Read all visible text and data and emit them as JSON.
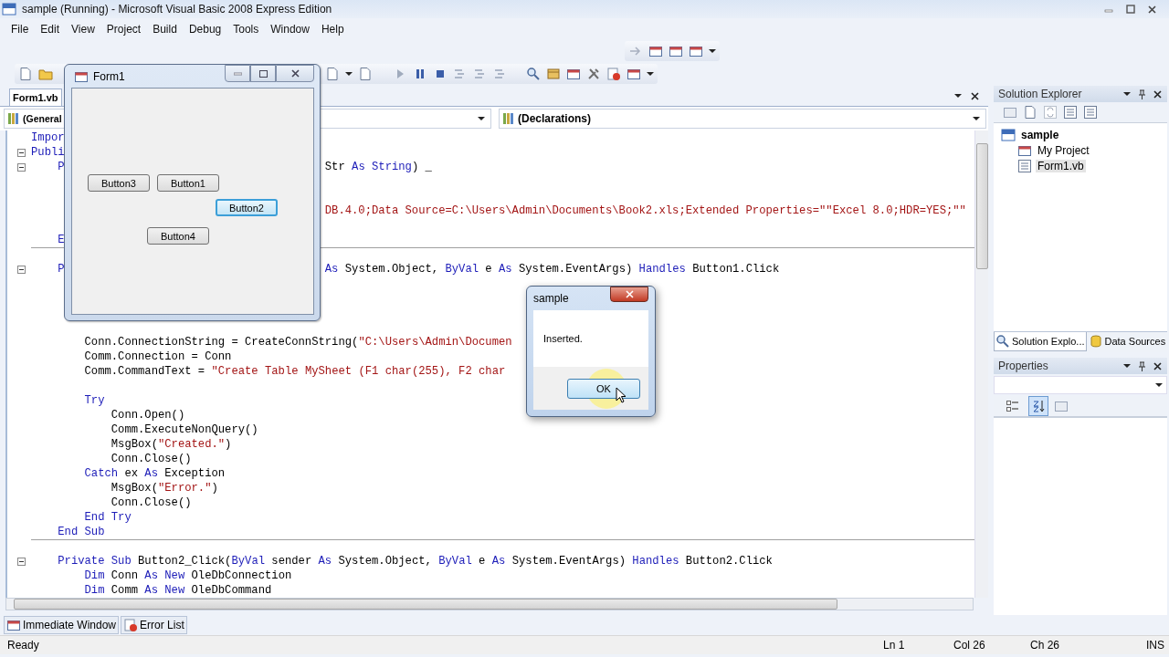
{
  "window": {
    "title": "sample (Running) - Microsoft Visual Basic 2008 Express Edition"
  },
  "menu": [
    "File",
    "Edit",
    "View",
    "Project",
    "Build",
    "Debug",
    "Tools",
    "Window",
    "Help"
  ],
  "document_tabs": [
    {
      "label": "Form1.vb",
      "selected": true
    }
  ],
  "editor": {
    "class_combo": "(General",
    "method_combo": "(Declarations)",
    "lines": [
      {
        "kind": "line",
        "segments": [
          {
            "kind": "keyword",
            "text": "Impor"
          }
        ]
      },
      {
        "kind": "fold",
        "segments": [
          {
            "kind": "keyword",
            "text": "Publi"
          }
        ]
      },
      {
        "kind": "fold",
        "segments": [
          {
            "kind": "keyword",
            "text": "    P"
          }
        ],
        "tail": [
          {
            "kind": "plain",
            "text": "Str "
          },
          {
            "kind": "keyword",
            "text": "As String"
          },
          {
            "kind": "plain",
            "text": ") _"
          }
        ]
      },
      {
        "kind": "blank"
      },
      {
        "kind": "blank"
      },
      {
        "kind": "line",
        "tail": [
          {
            "kind": "string",
            "text": "DB.4.0;Data Source=C:\\Users\\Admin\\Documents\\Book2.xls;Extended Properties=\"\"Excel 8.0;HDR=YES;\"\""
          }
        ]
      },
      {
        "kind": "blank"
      },
      {
        "kind": "end",
        "segments": [
          {
            "kind": "keyword",
            "text": "    E"
          }
        ]
      },
      {
        "kind": "blank"
      },
      {
        "kind": "fold",
        "segments": [
          {
            "kind": "keyword",
            "text": "    P"
          }
        ],
        "tail": [
          {
            "kind": "keyword",
            "text": "As"
          },
          {
            "kind": "plain",
            "text": " System.Object, "
          },
          {
            "kind": "keyword",
            "text": "ByVal"
          },
          {
            "kind": "plain",
            "text": " e "
          },
          {
            "kind": "keyword",
            "text": "As"
          },
          {
            "kind": "plain",
            "text": " System.EventArgs) "
          },
          {
            "kind": "keyword",
            "text": "Handles"
          },
          {
            "kind": "plain",
            "text": " Button1.Click"
          }
        ]
      },
      {
        "kind": "blank"
      },
      {
        "kind": "blank"
      },
      {
        "kind": "blank"
      },
      {
        "kind": "blank"
      },
      {
        "kind": "line",
        "segments": [
          {
            "kind": "plain",
            "text": "        Conn.ConnectionString = CreateConnString("
          },
          {
            "kind": "string",
            "text": "\"C:\\Users\\Admin\\Documen"
          }
        ]
      },
      {
        "kind": "line",
        "segments": [
          {
            "kind": "plain",
            "text": "        Comm.Connection = Conn"
          }
        ]
      },
      {
        "kind": "line",
        "segments": [
          {
            "kind": "plain",
            "text": "        Comm.CommandText = "
          },
          {
            "kind": "string",
            "text": "\"Create Table MySheet (F1 char(255), F2 char"
          }
        ]
      },
      {
        "kind": "blank"
      },
      {
        "kind": "line",
        "segments": [
          {
            "kind": "keyword",
            "text": "        Try"
          }
        ]
      },
      {
        "kind": "line",
        "segments": [
          {
            "kind": "plain",
            "text": "            Conn.Open()"
          }
        ]
      },
      {
        "kind": "line",
        "segments": [
          {
            "kind": "plain",
            "text": "            Comm.ExecuteNonQuery()"
          }
        ]
      },
      {
        "kind": "line",
        "segments": [
          {
            "kind": "plain",
            "text": "            MsgBox("
          },
          {
            "kind": "string",
            "text": "\"Created.\""
          },
          {
            "kind": "plain",
            "text": ")"
          }
        ]
      },
      {
        "kind": "line",
        "segments": [
          {
            "kind": "plain",
            "text": "            Conn.Close()"
          }
        ]
      },
      {
        "kind": "line",
        "segments": [
          {
            "kind": "keyword",
            "text": "        Catch"
          },
          {
            "kind": "plain",
            "text": " ex "
          },
          {
            "kind": "keyword",
            "text": "As"
          },
          {
            "kind": "plain",
            "text": " Exception"
          }
        ]
      },
      {
        "kind": "line",
        "segments": [
          {
            "kind": "plain",
            "text": "            MsgBox("
          },
          {
            "kind": "string",
            "text": "\"Error.\""
          },
          {
            "kind": "plain",
            "text": ")"
          }
        ]
      },
      {
        "kind": "line",
        "segments": [
          {
            "kind": "plain",
            "text": "            Conn.Close()"
          }
        ]
      },
      {
        "kind": "line",
        "segments": [
          {
            "kind": "keyword",
            "text": "        End Try"
          }
        ]
      },
      {
        "kind": "end",
        "segments": [
          {
            "kind": "keyword",
            "text": "    End Sub"
          }
        ]
      },
      {
        "kind": "blank"
      },
      {
        "kind": "fold",
        "segments": [
          {
            "kind": "keyword",
            "text": "    Private Sub"
          },
          {
            "kind": "plain",
            "text": " Button2_Click("
          },
          {
            "kind": "keyword",
            "text": "ByVal"
          },
          {
            "kind": "plain",
            "text": " sender "
          },
          {
            "kind": "keyword",
            "text": "As"
          },
          {
            "kind": "plain",
            "text": " System.Object, "
          },
          {
            "kind": "keyword",
            "text": "ByVal"
          },
          {
            "kind": "plain",
            "text": " e "
          },
          {
            "kind": "keyword",
            "text": "As"
          },
          {
            "kind": "plain",
            "text": " System.EventArgs) "
          },
          {
            "kind": "keyword",
            "text": "Handles"
          },
          {
            "kind": "plain",
            "text": " Button2.Click"
          }
        ]
      },
      {
        "kind": "line",
        "segments": [
          {
            "kind": "keyword",
            "text": "        Dim"
          },
          {
            "kind": "plain",
            "text": " Conn "
          },
          {
            "kind": "keyword",
            "text": "As New"
          },
          {
            "kind": "plain",
            "text": " OleDbConnection"
          }
        ]
      },
      {
        "kind": "line",
        "segments": [
          {
            "kind": "keyword",
            "text": "        Dim"
          },
          {
            "kind": "plain",
            "text": " Comm "
          },
          {
            "kind": "keyword",
            "text": "As New"
          },
          {
            "kind": "plain",
            "text": " OleDbCommand"
          }
        ]
      }
    ]
  },
  "solution_explorer": {
    "title": "Solution Explorer",
    "tree": [
      {
        "label": "sample",
        "selected": false,
        "children": [
          {
            "label": "My Project",
            "selected": false
          },
          {
            "label": "Form1.vb",
            "selected": true
          }
        ]
      }
    ]
  },
  "panel_tabs": [
    {
      "label": "Solution Explo...",
      "selected": true
    },
    {
      "label": "Data Sources",
      "selected": false
    }
  ],
  "properties": {
    "title": "Properties",
    "sort_buttons": [
      {
        "kind": "categorized",
        "selected": false
      },
      {
        "kind": "alphabetical",
        "selected": true
      }
    ]
  },
  "bottom_tabs": [
    {
      "label": "Immediate Window",
      "selected": false
    },
    {
      "label": "Error List",
      "selected": false
    }
  ],
  "status_bar": {
    "message": "Ready",
    "line": "Ln 1",
    "column": "Col 26",
    "character": "Ch 26",
    "mode": "INS"
  },
  "form_window": {
    "title": "Form1",
    "buttons": [
      {
        "label": "Button3",
        "focused": false
      },
      {
        "label": "Button1",
        "focused": false
      },
      {
        "label": "Button2",
        "focused": true
      },
      {
        "label": "Button4",
        "focused": false
      }
    ]
  },
  "message_box": {
    "title": "sample",
    "message": "Inserted.",
    "button": {
      "label": "OK",
      "hovered": true
    }
  }
}
